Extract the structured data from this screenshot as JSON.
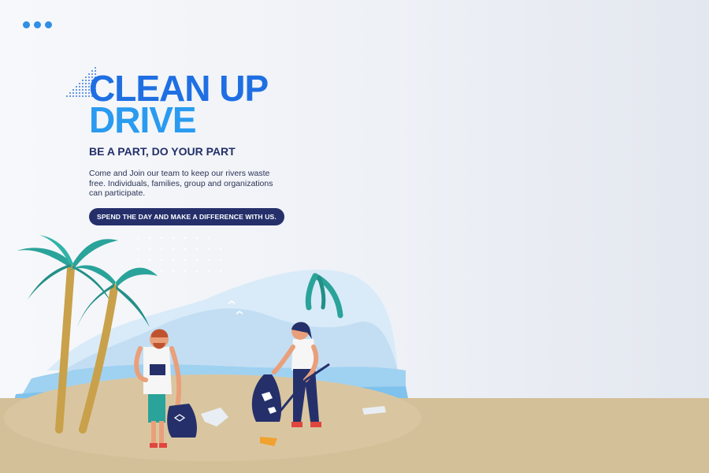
{
  "menu": {
    "icon": "more-dots-icon"
  },
  "hero": {
    "title_line1": "CLEAN UP",
    "title_line2": "DRIVE",
    "tagline": "BE A PART, DO YOUR PART",
    "description": "Come and Join our team to keep our rivers waste free. Individuals, families, group and organizations can participate.",
    "cta_label": "SPEND THE DAY AND MAKE A DIFFERENCE WITH US."
  },
  "colors": {
    "title_primary": "#1f6fe3",
    "title_secondary": "#2a9bf0",
    "navy": "#25306b",
    "sand": "#d3bf98",
    "palm": "#2aa39a",
    "sea": "#cfe6f6"
  }
}
